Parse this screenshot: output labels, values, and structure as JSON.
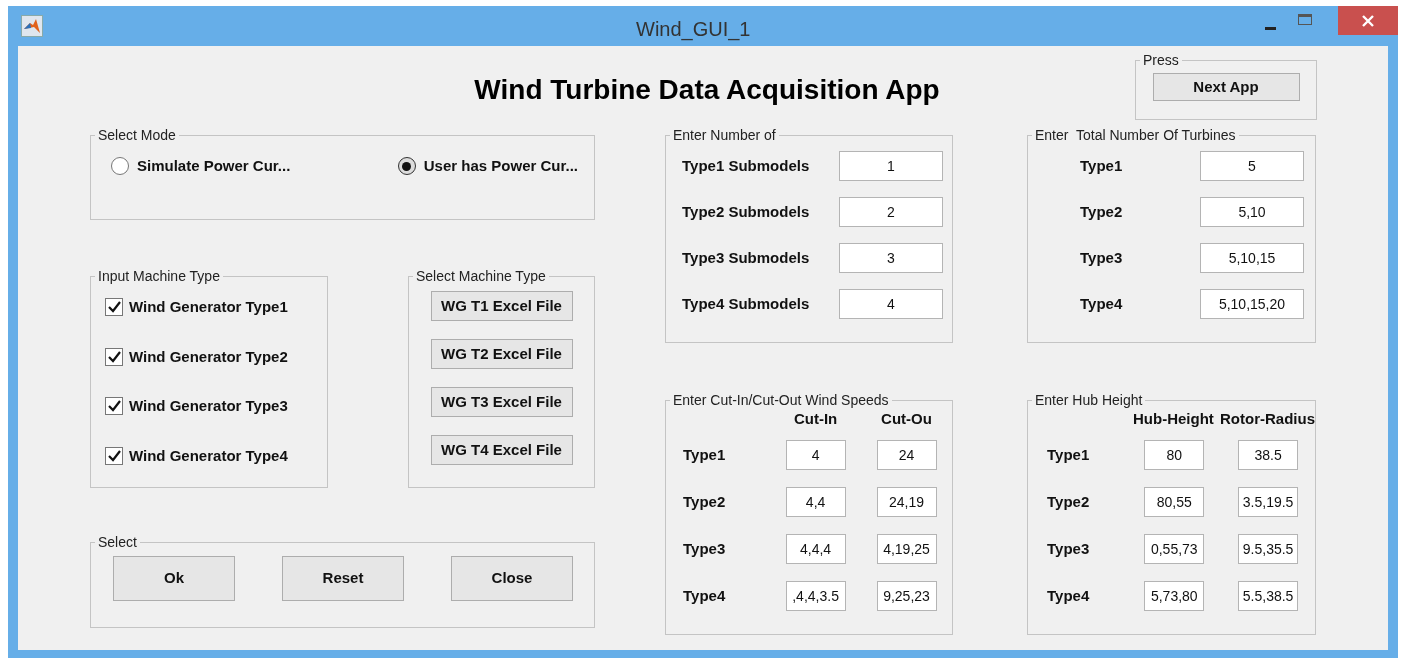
{
  "window": {
    "title": "Wind_GUI_1"
  },
  "app_title": "Wind Turbine Data Acquisition App",
  "press_panel": {
    "title": "Press",
    "button": "Next App"
  },
  "select_mode": {
    "title": "Select Mode",
    "options": [
      {
        "label": "Simulate Power Cur...",
        "selected": false
      },
      {
        "label": "User has Power Cur...",
        "selected": true
      }
    ]
  },
  "input_machine_type": {
    "title": "Input Machine Type",
    "items": [
      {
        "label": "Wind Generator Type1",
        "checked": true
      },
      {
        "label": "Wind Generator Type2",
        "checked": true
      },
      {
        "label": "Wind Generator Type3",
        "checked": true
      },
      {
        "label": "Wind Generator Type4",
        "checked": true
      }
    ]
  },
  "select_machine_type": {
    "title": "Select Machine Type",
    "buttons": [
      "WG T1 Excel File",
      "WG T2 Excel File",
      "WG T3 Excel File",
      "WG T4 Excel File"
    ]
  },
  "select_panel": {
    "title": "Select",
    "buttons": [
      "Ok",
      "Reset",
      "Close"
    ]
  },
  "number_of": {
    "title": "Enter Number of",
    "rows": [
      {
        "label": "Type1 Submodels",
        "value": "1"
      },
      {
        "label": "Type2 Submodels",
        "value": "2"
      },
      {
        "label": "Type3 Submodels",
        "value": "3"
      },
      {
        "label": "Type4 Submodels",
        "value": "4"
      }
    ]
  },
  "total_turbines": {
    "title": "Enter  Total Number Of Turbines",
    "rows": [
      {
        "label": "Type1",
        "value": "5"
      },
      {
        "label": "Type2",
        "value": "5,10"
      },
      {
        "label": "Type3",
        "value": "5,10,15"
      },
      {
        "label": "Type4",
        "value": "5,10,15,20"
      }
    ]
  },
  "cut_speeds": {
    "title": "Enter Cut-In/Cut-Out Wind Speeds",
    "columns": [
      "Cut-In",
      "Cut-Ou"
    ],
    "rows": [
      {
        "label": "Type1",
        "values": [
          "4",
          "24"
        ]
      },
      {
        "label": "Type2",
        "values": [
          "4,4",
          "24,19"
        ]
      },
      {
        "label": "Type3",
        "values": [
          "4,4,4",
          "4,19,25"
        ]
      },
      {
        "label": "Type4",
        "values": [
          ",4,4,3.5",
          "9,25,23"
        ]
      }
    ]
  },
  "hub_height": {
    "title": "Enter Hub Height",
    "columns": [
      "Hub-Height",
      "Rotor-Radius"
    ],
    "rows": [
      {
        "label": "Type1",
        "values": [
          "80",
          "38.5"
        ]
      },
      {
        "label": "Type2",
        "values": [
          "80,55",
          "3.5,19.5"
        ]
      },
      {
        "label": "Type3",
        "values": [
          "0,55,73",
          "9.5,35.5"
        ]
      },
      {
        "label": "Type4",
        "values": [
          "5,73,80",
          "5.5,38.5"
        ]
      }
    ]
  }
}
